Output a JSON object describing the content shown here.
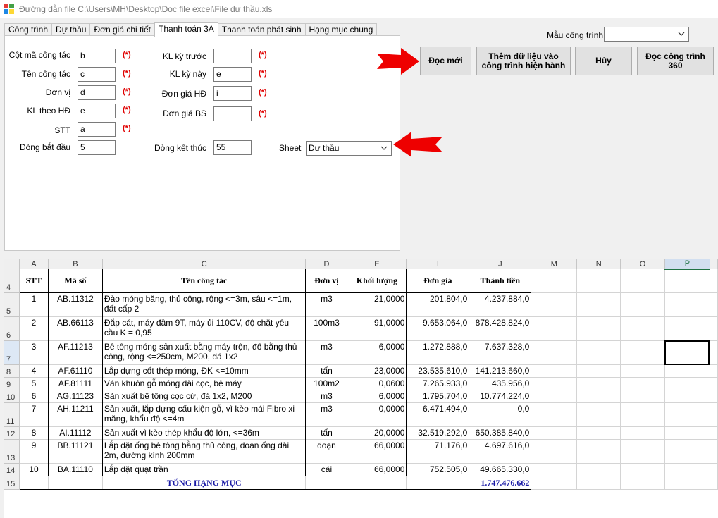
{
  "window": {
    "title": "Đường dẫn file C:\\Users\\MH\\Desktop\\Doc file excel\\File dự thầu.xls"
  },
  "tabs": [
    "Công trình",
    "Dự thầu",
    "Đơn giá chi tiết",
    "Thanh toán 3A",
    "Thanh toán phát sinh",
    "Hạng mục chung"
  ],
  "active_tab": "Thanh toán 3A",
  "form": {
    "cot_ma": {
      "label": "Cột mã công tác",
      "value": "b"
    },
    "ten_cong_tac": {
      "label": "Tên công tác",
      "value": "c"
    },
    "don_vi": {
      "label": "Đơn vị",
      "value": "d"
    },
    "kl_theo_hd": {
      "label": "KL theo HĐ",
      "value": "e"
    },
    "stt": {
      "label": "STT",
      "value": "a"
    },
    "dong_bat_dau": {
      "label": "Dòng bắt đầu",
      "value": "5"
    },
    "kl_ky_truoc": {
      "label": "KL kỳ trước",
      "value": ""
    },
    "kl_ky_nay": {
      "label": "KL kỳ này",
      "value": "e"
    },
    "don_gia_hd": {
      "label": "Đơn giá HĐ",
      "value": "i"
    },
    "don_gia_bs": {
      "label": "Đơn giá BS",
      "value": ""
    },
    "dong_ket_thuc": {
      "label": "Dòng kết thúc",
      "value": "55"
    },
    "sheet": {
      "label": "Sheet",
      "value": "Dự thầu"
    },
    "required_mark": "(*)"
  },
  "template": {
    "label": "Mẫu công trình",
    "value": ""
  },
  "buttons": {
    "doc_moi": "Đọc mới",
    "them_du_lieu": "Thêm dữ liệu vào công trình hiện hành",
    "huy": "Hủy",
    "doc_360": "Đọc công trình 360"
  },
  "spreadsheet": {
    "columns": [
      "A",
      "B",
      "C",
      "D",
      "E",
      "I",
      "J",
      "M",
      "N",
      "O",
      "P"
    ],
    "selected_column": "P",
    "selected_row": "7",
    "headers": {
      "stt": "STT",
      "ma_so": "Mã số",
      "ten": "Tên công tác",
      "don_vi": "Đơn vị",
      "khoi_luong": "Khối lượng",
      "don_gia": "Đơn giá",
      "thanh_tien": "Thành tiền"
    },
    "header_row": "4",
    "rows": [
      {
        "r": "5",
        "stt": "1",
        "ma": "AB.11312",
        "ten": "Đào móng băng, thủ công, rộng <=3m, sâu <=1m, đất cấp 2",
        "dv": "m3",
        "kl": "21,0000",
        "dg": "201.804,0",
        "tt": "4.237.884,0"
      },
      {
        "r": "6",
        "stt": "2",
        "ma": "AB.66113",
        "ten": "Đắp cát, máy đầm 9T, máy ủi 110CV, độ chặt yêu cầu K = 0,95",
        "dv": "100m3",
        "kl": "91,0000",
        "dg": "9.653.064,0",
        "tt": "878.428.824,0"
      },
      {
        "r": "7",
        "stt": "3",
        "ma": "AF.11213",
        "ten": "Bê tông móng sản xuất bằng máy trộn, đổ bằng thủ công, rộng <=250cm, M200, đá 1x2",
        "dv": "m3",
        "kl": "6,0000",
        "dg": "1.272.888,0",
        "tt": "7.637.328,0"
      },
      {
        "r": "8",
        "stt": "4",
        "ma": "AF.61110",
        "ten": "Lắp dựng cốt thép móng, ĐK <=10mm",
        "dv": "tấn",
        "kl": "23,0000",
        "dg": "23.535.610,0",
        "tt": "141.213.660,0"
      },
      {
        "r": "9",
        "stt": "5",
        "ma": "AF.81111",
        "ten": "Ván khuôn gỗ móng dài cọc, bệ máy",
        "dv": "100m2",
        "kl": "0,0600",
        "dg": "7.265.933,0",
        "tt": "435.956,0"
      },
      {
        "r": "10",
        "stt": "6",
        "ma": "AG.11123",
        "ten": "Sản xuất bê tông cọc cừ, đá 1x2, M200",
        "dv": "m3",
        "kl": "6,0000",
        "dg": "1.795.704,0",
        "tt": "10.774.224,0"
      },
      {
        "r": "11",
        "stt": "7",
        "ma": "AH.11211",
        "ten": "Sản xuất, lắp dựng cấu kiện gỗ, vì kèo mái Fibro xi măng, khẩu độ <=4m",
        "dv": "m3",
        "kl": "0,0000",
        "dg": "6.471.494,0",
        "tt": "0,0"
      },
      {
        "r": "12",
        "stt": "8",
        "ma": "AI.11112",
        "ten": "Sản xuất vì kèo thép khẩu độ lớn, <=36m",
        "dv": "tấn",
        "kl": "20,0000",
        "dg": "32.519.292,0",
        "tt": "650.385.840,0"
      },
      {
        "r": "13",
        "stt": "9",
        "ma": "BB.11121",
        "ten": "Lắp đặt ống bê tông bằng thủ công, đoạn ống dài 2m, đường kính 200mm",
        "dv": "đoạn",
        "kl": "66,0000",
        "dg": "71.176,0",
        "tt": "4.697.616,0"
      },
      {
        "r": "14",
        "stt": "10",
        "ma": "BA.11110",
        "ten": "Lắp đặt quạt trần",
        "dv": "cái",
        "kl": "66,0000",
        "dg": "752.505,0",
        "tt": "49.665.330,0"
      }
    ],
    "total": {
      "r": "15",
      "label": "TỔNG HẠNG MỤC",
      "value": "1.747.476.662"
    }
  },
  "colors": {
    "required": "#e00000",
    "arrow": "#ee0000",
    "total_text": "#1a1aa6",
    "excel_green": "#217346"
  }
}
